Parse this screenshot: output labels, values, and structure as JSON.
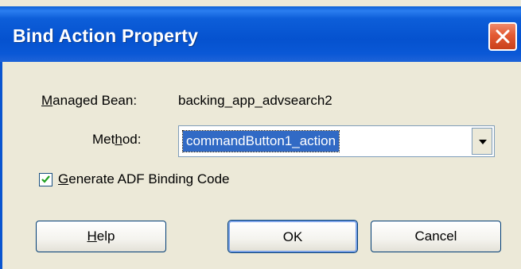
{
  "dialog": {
    "title": "Bind Action Property"
  },
  "managed_bean": {
    "label_mnemonic": "M",
    "label_rest": "anaged Bean:",
    "value": "backing_app_advsearch2"
  },
  "method": {
    "label_pre": "Met",
    "label_mnemonic": "h",
    "label_post": "od:",
    "value": "commandButton1_action"
  },
  "generate_binding": {
    "checked": true,
    "label_mnemonic": "G",
    "label_rest": "enerate ADF Binding Code"
  },
  "buttons": {
    "help_mnemonic": "H",
    "help_rest": "elp",
    "ok_label": "OK",
    "cancel_label": "Cancel"
  },
  "colors": {
    "title_bar": "#0552cf",
    "dialog_bg": "#ece9d8",
    "selection": "#316ac5",
    "close_button": "#e35a33"
  },
  "icons": {
    "close": "close-x-icon",
    "dropdown": "chevron-down-icon",
    "check": "checkmark-icon"
  }
}
